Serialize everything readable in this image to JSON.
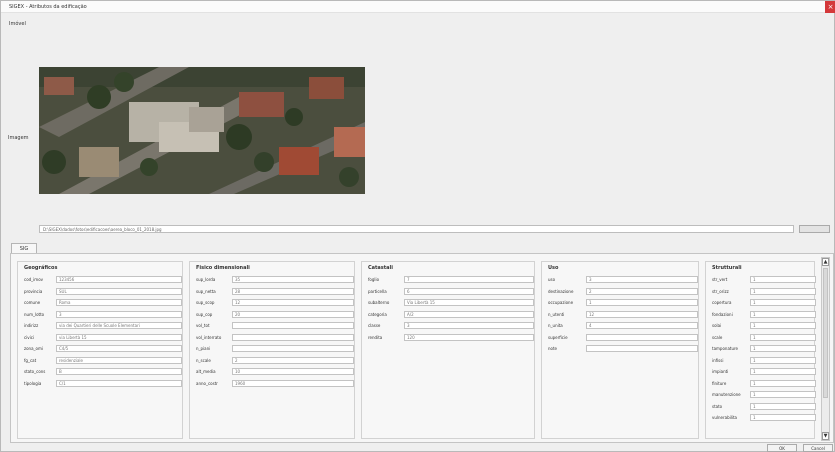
{
  "window": {
    "title": "SIGEX - Atributos da edificação",
    "close_glyph": "×"
  },
  "menu": {
    "label": "Imóvel"
  },
  "image": {
    "label": "Imagem",
    "path": "D:\\SIGEX\\dados\\fotos\\edificacoes\\aerea_bloco_01_2018.jpg",
    "browse_label": ""
  },
  "tabs": [
    {
      "label": "SIG"
    }
  ],
  "groups": [
    {
      "title": "Geográficos",
      "fields": [
        {
          "label": "cod_imov",
          "value": "123456"
        },
        {
          "label": "provincia",
          "value": "SUL"
        },
        {
          "label": "comune",
          "value": "Roma"
        },
        {
          "label": "num_lotto",
          "value": "3"
        },
        {
          "label": "indirizz",
          "value": "via dei Quartieri delle Scuole Elementari"
        },
        {
          "label": "civici",
          "value": "via Libertà 15"
        },
        {
          "label": "zona_omi",
          "value": "C4/5"
        },
        {
          "label": "fg_cat",
          "value": "residenziale"
        },
        {
          "label": "stato_cons",
          "value": "B"
        },
        {
          "label": "tipologia",
          "value": "C/1"
        }
      ]
    },
    {
      "title": "Fisico dimensionali",
      "fields": [
        {
          "label": "sup_lorda",
          "value": "35"
        },
        {
          "label": "sup_netta",
          "value": "28"
        },
        {
          "label": "sup_scop",
          "value": "12"
        },
        {
          "label": "sup_cop",
          "value": "20"
        },
        {
          "label": "vol_tot",
          "value": ""
        },
        {
          "label": "vol_interrato",
          "value": ""
        },
        {
          "label": "n_piani",
          "value": ""
        },
        {
          "label": "n_scale",
          "value": "2"
        },
        {
          "label": "alt_media",
          "value": "10"
        },
        {
          "label": "anno_costr",
          "value": "1960"
        }
      ]
    },
    {
      "title": "Catastali",
      "fields": [
        {
          "label": "foglio",
          "value": "7"
        },
        {
          "label": "particella",
          "value": "6"
        },
        {
          "label": "subalterno",
          "value": "Via Libertà 15"
        },
        {
          "label": "categoria",
          "value": "A/2"
        },
        {
          "label": "classe",
          "value": "3"
        },
        {
          "label": "rendita",
          "value": "120"
        }
      ]
    },
    {
      "title": "Uso",
      "fields": [
        {
          "label": "uso",
          "value": "3"
        },
        {
          "label": "destinazione",
          "value": "2"
        },
        {
          "label": "occupazione",
          "value": "1"
        },
        {
          "label": "n_utenti",
          "value": "12"
        },
        {
          "label": "n_unita",
          "value": "4"
        },
        {
          "label": "superficie",
          "value": ""
        },
        {
          "label": "note",
          "value": ""
        }
      ]
    },
    {
      "title": "Strutturali",
      "fields": [
        {
          "label": "str_vert",
          "value": "1"
        },
        {
          "label": "str_orizz",
          "value": "1"
        },
        {
          "label": "copertura",
          "value": "1"
        },
        {
          "label": "fondazioni",
          "value": "1"
        },
        {
          "label": "solai",
          "value": "1"
        },
        {
          "label": "scale",
          "value": "1"
        },
        {
          "label": "tamponature",
          "value": "1"
        },
        {
          "label": "infissi",
          "value": "1"
        },
        {
          "label": "impianti",
          "value": "1"
        },
        {
          "label": "finiture",
          "value": "1"
        },
        {
          "label": "manutenzione",
          "value": "1"
        },
        {
          "label": "stato",
          "value": "1"
        },
        {
          "label": "vulnerabilita",
          "value": "1"
        }
      ]
    }
  ],
  "buttons": {
    "ok": "OK",
    "cancel": "Cancel"
  },
  "colors": {
    "close": "#d4383a",
    "panel": "#f6f6f6"
  }
}
